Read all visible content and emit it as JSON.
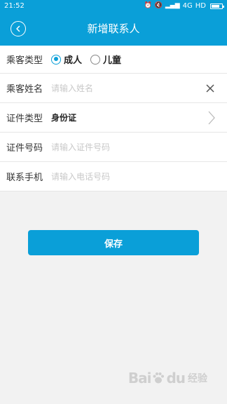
{
  "status_bar": {
    "time": "21:52",
    "network": "4G",
    "quality": "HD"
  },
  "nav": {
    "title": "新增联系人"
  },
  "form": {
    "passenger_type": {
      "label": "乘客类型",
      "options": [
        "成人",
        "儿童"
      ],
      "selected": "成人"
    },
    "name": {
      "label": "乘客姓名",
      "placeholder": "请输入姓名"
    },
    "id_type": {
      "label": "证件类型",
      "value": "身份证"
    },
    "id_number": {
      "label": "证件号码",
      "placeholder": "请输入证件号码"
    },
    "phone": {
      "label": "联系手机",
      "placeholder": "请输入电话号码"
    }
  },
  "actions": {
    "save_label": "保存"
  },
  "watermark": {
    "text_left": "Bai",
    "text_right": "经验",
    "text_sub": "du"
  },
  "colors": {
    "accent": "#0a9fd8",
    "background": "#f2f2f2"
  }
}
